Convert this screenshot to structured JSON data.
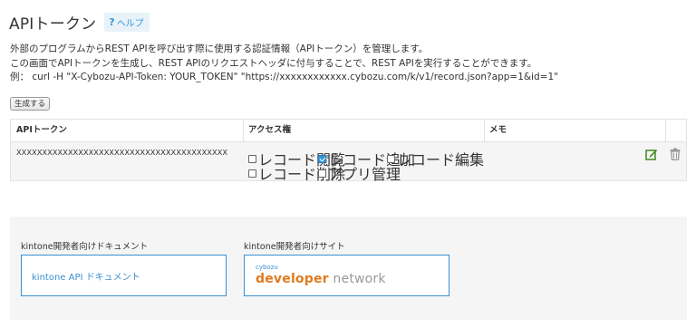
{
  "header": {
    "title": "APIトークン",
    "help_icon": "?",
    "help_label": "ヘルプ"
  },
  "description": {
    "line1": "外部のプログラムからREST APIを呼び出す際に使用する認証情報（APIトークン）を管理します。",
    "line2": "この画面でAPIトークンを生成し、REST APIのリクエストヘッダに付与することで、REST APIを実行することができます。",
    "line3": "例： curl -H \"X-Cybozu-API-Token: YOUR_TOKEN\" \"https://xxxxxxxxxxxx.cybozu.com/k/v1/record.json?app=1&id=1\""
  },
  "generate_button": "生成する",
  "table": {
    "headers": [
      "APIトークン",
      "アクセス権",
      "メモ"
    ],
    "rows": [
      {
        "token": "XXXXXXXXXXXXXXXXXXXXXXXXXXXXXXXXXXXXXXXXX",
        "permissions": [
          {
            "label": "レコード閲覧",
            "checked": false
          },
          {
            "label": "レコード追加",
            "checked": true
          },
          {
            "label": "レコード編集",
            "checked": false
          },
          {
            "label": "レコード削除",
            "checked": false
          },
          {
            "label": "アプリ管理",
            "checked": false
          }
        ],
        "memo": ""
      }
    ]
  },
  "footer": {
    "docs_label": "kintone開発者向けドキュメント",
    "docs_link": "kintone API ドキュメント",
    "site_label": "kintone開発者向けサイト",
    "site_logo_small": "cybozu",
    "site_logo_main": "developer",
    "site_logo_net": " network"
  },
  "colors": {
    "accent": "#3498db",
    "logo_orange": "#e07b1d",
    "table_row_bg": "#f5f5f5"
  },
  "icons": {
    "edit": "edit-icon",
    "delete": "trash-icon"
  }
}
